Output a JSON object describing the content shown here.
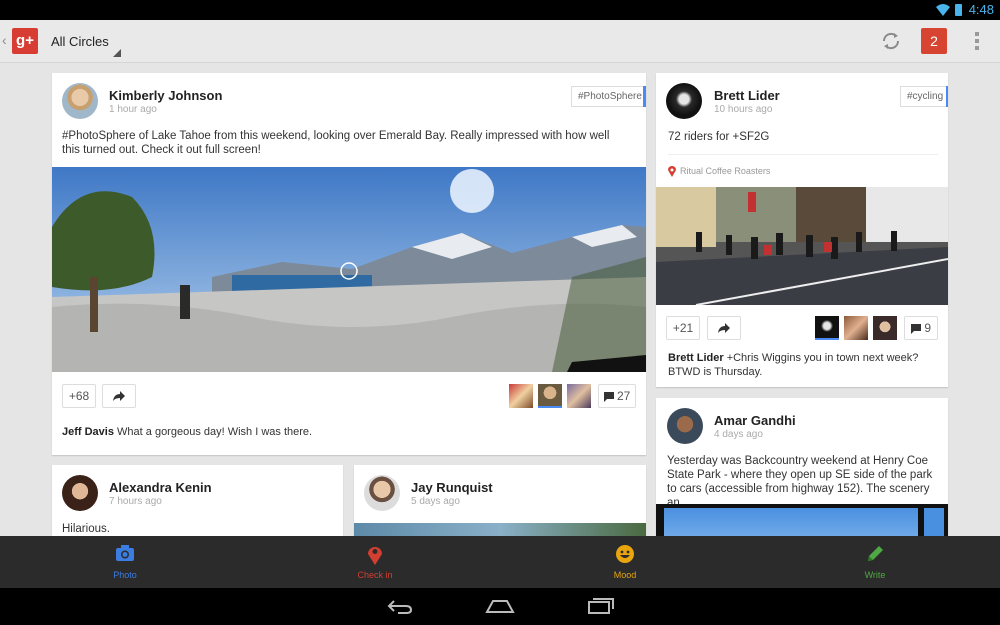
{
  "status": {
    "time": "4:48"
  },
  "actionbar": {
    "title": "All Circles",
    "logo": "g+",
    "notifications": "2"
  },
  "posts": [
    {
      "author": "Kimberly Johnson",
      "time": "1 hour ago",
      "tag": "#PhotoSphere",
      "text": "#PhotoSphere  of Lake Tahoe from this weekend, looking over Emerald Bay. Really impressed with how well this turned out. Check it out full screen!",
      "plus": "+68",
      "comments": "27",
      "comment_author": "Jeff Davis",
      "comment_text": "What a gorgeous day! Wish I was there."
    },
    {
      "author": "Brett Lider",
      "time": "10 hours ago",
      "tag": "#cycling",
      "text": "72 riders for +SF2G",
      "location": "Ritual Coffee Roasters",
      "plus": "+21",
      "comments": "9",
      "comment_author": "Brett Lider",
      "comment_text": "+Chris Wiggins you in town next week? BTWD is Thursday."
    },
    {
      "author": "Alexandra Kenin",
      "time": "7 hours ago",
      "text": "Hilarious."
    },
    {
      "author": "Jay Runquist",
      "time": "5 days ago"
    },
    {
      "author": "Amar Gandhi",
      "time": "4 days ago",
      "text": "Yesterday was Backcountry weekend at Henry Coe State Park - where they open up SE side of the park to cars (accessible from highway 152).  The scenery an…"
    }
  ],
  "bottom": {
    "photo": "Photo",
    "checkin": "Check in",
    "mood": "Mood",
    "write": "Write"
  },
  "colors": {
    "photo": "#3b7de0",
    "checkin": "#d23f31",
    "mood": "#e8a50e",
    "write": "#4fa843"
  }
}
